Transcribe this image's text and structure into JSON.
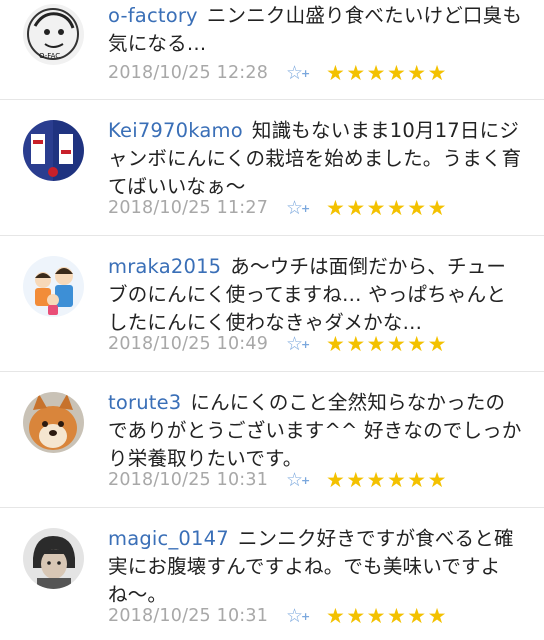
{
  "comments": [
    {
      "username": "o-factory",
      "text": "ニンニク山盛り食べたいけど口臭も気になる…",
      "timestamp": "2018/10/25 12:28",
      "stars": "★★★★★★",
      "avatar_text": "O-FAC"
    },
    {
      "username": "Kei7970kamo",
      "text": "知識もないまま10月17日にジャンボにんにくの栽培を始めました。うまく育てばいいなぁ〜",
      "timestamp": "2018/10/25 11:27",
      "stars": "★★★★★★"
    },
    {
      "username": "mraka2015",
      "text": "あ〜ウチは面倒だから、チューブのにんにく使ってますね… やっぱちゃんとしたにんにく使わなきゃダメかな…",
      "timestamp": "2018/10/25 10:49",
      "stars": "★★★★★★"
    },
    {
      "username": "torute3",
      "text": "にんにくのこと全然知らなかったのでありがとうございます^^ 好きなのでしっかり栄養取りたいです。",
      "timestamp": "2018/10/25 10:31",
      "stars": "★★★★★★"
    },
    {
      "username": "magic_0147",
      "text": "ニンニク好きですが食べると確実にお腹壊すんですよね。でも美味いですよね〜。",
      "timestamp": "2018/10/25 10:31",
      "stars": "★★★★★★"
    }
  ],
  "icons": {
    "add_star": "☆",
    "add_star_plus": "+"
  },
  "colors": {
    "username": "#3a6fb7",
    "timestamp": "#a8a8a8",
    "star": "#f3c100",
    "add_star": "#7aa7dd"
  }
}
